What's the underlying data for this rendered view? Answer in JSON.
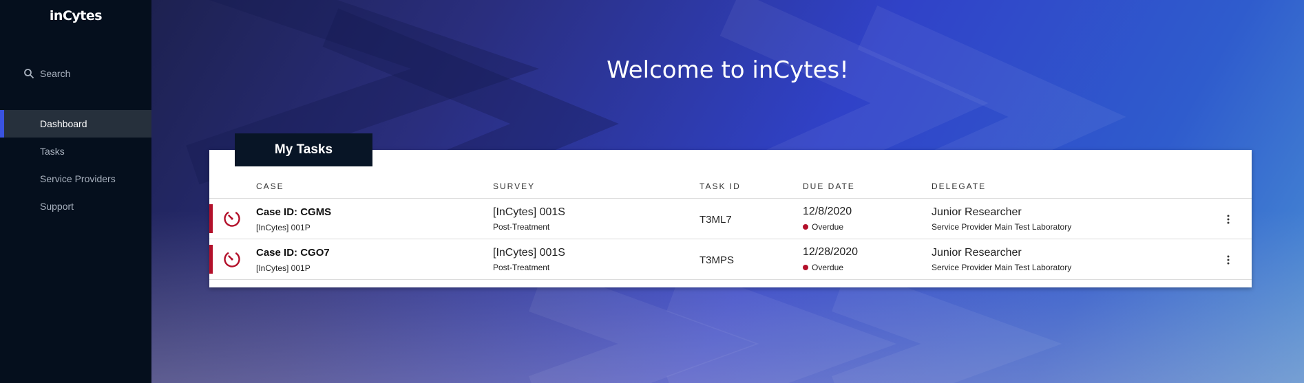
{
  "app": {
    "logo": "inCytes"
  },
  "sidebar": {
    "search_label": "Search",
    "items": [
      {
        "label": "Dashboard",
        "active": true
      },
      {
        "label": "Tasks"
      },
      {
        "label": "Service Providers"
      },
      {
        "label": "Support"
      }
    ]
  },
  "main": {
    "welcome": "Welcome to inCytes!",
    "tasks": {
      "tab_label": "My Tasks",
      "columns": [
        "CASE",
        "SURVEY",
        "TASK ID",
        "DUE DATE",
        "DELEGATE"
      ],
      "rows": [
        {
          "case_id": "Case ID: CGMS",
          "case_sub": "[InCytes] 001P",
          "survey": "[InCytes] 001S",
          "survey_sub": "Post-Treatment",
          "task_id": "T3ML7",
          "due_date": "12/8/2020",
          "status": "Overdue",
          "delegate": "Junior Researcher",
          "delegate_sub": "Service Provider Main Test Laboratory"
        },
        {
          "case_id": "Case ID: CGO7",
          "case_sub": "[InCytes] 001P",
          "survey": "[InCytes] 001S",
          "survey_sub": "Post-Treatment",
          "task_id": "T3MPS",
          "due_date": "12/28/2020",
          "status": "Overdue",
          "delegate": "Junior Researcher",
          "delegate_sub": "Service Provider Main Test Laboratory"
        }
      ]
    }
  },
  "colors": {
    "accent": "#3a53e0",
    "overdue": "#b3102a",
    "sidebar": "#050f1d"
  }
}
